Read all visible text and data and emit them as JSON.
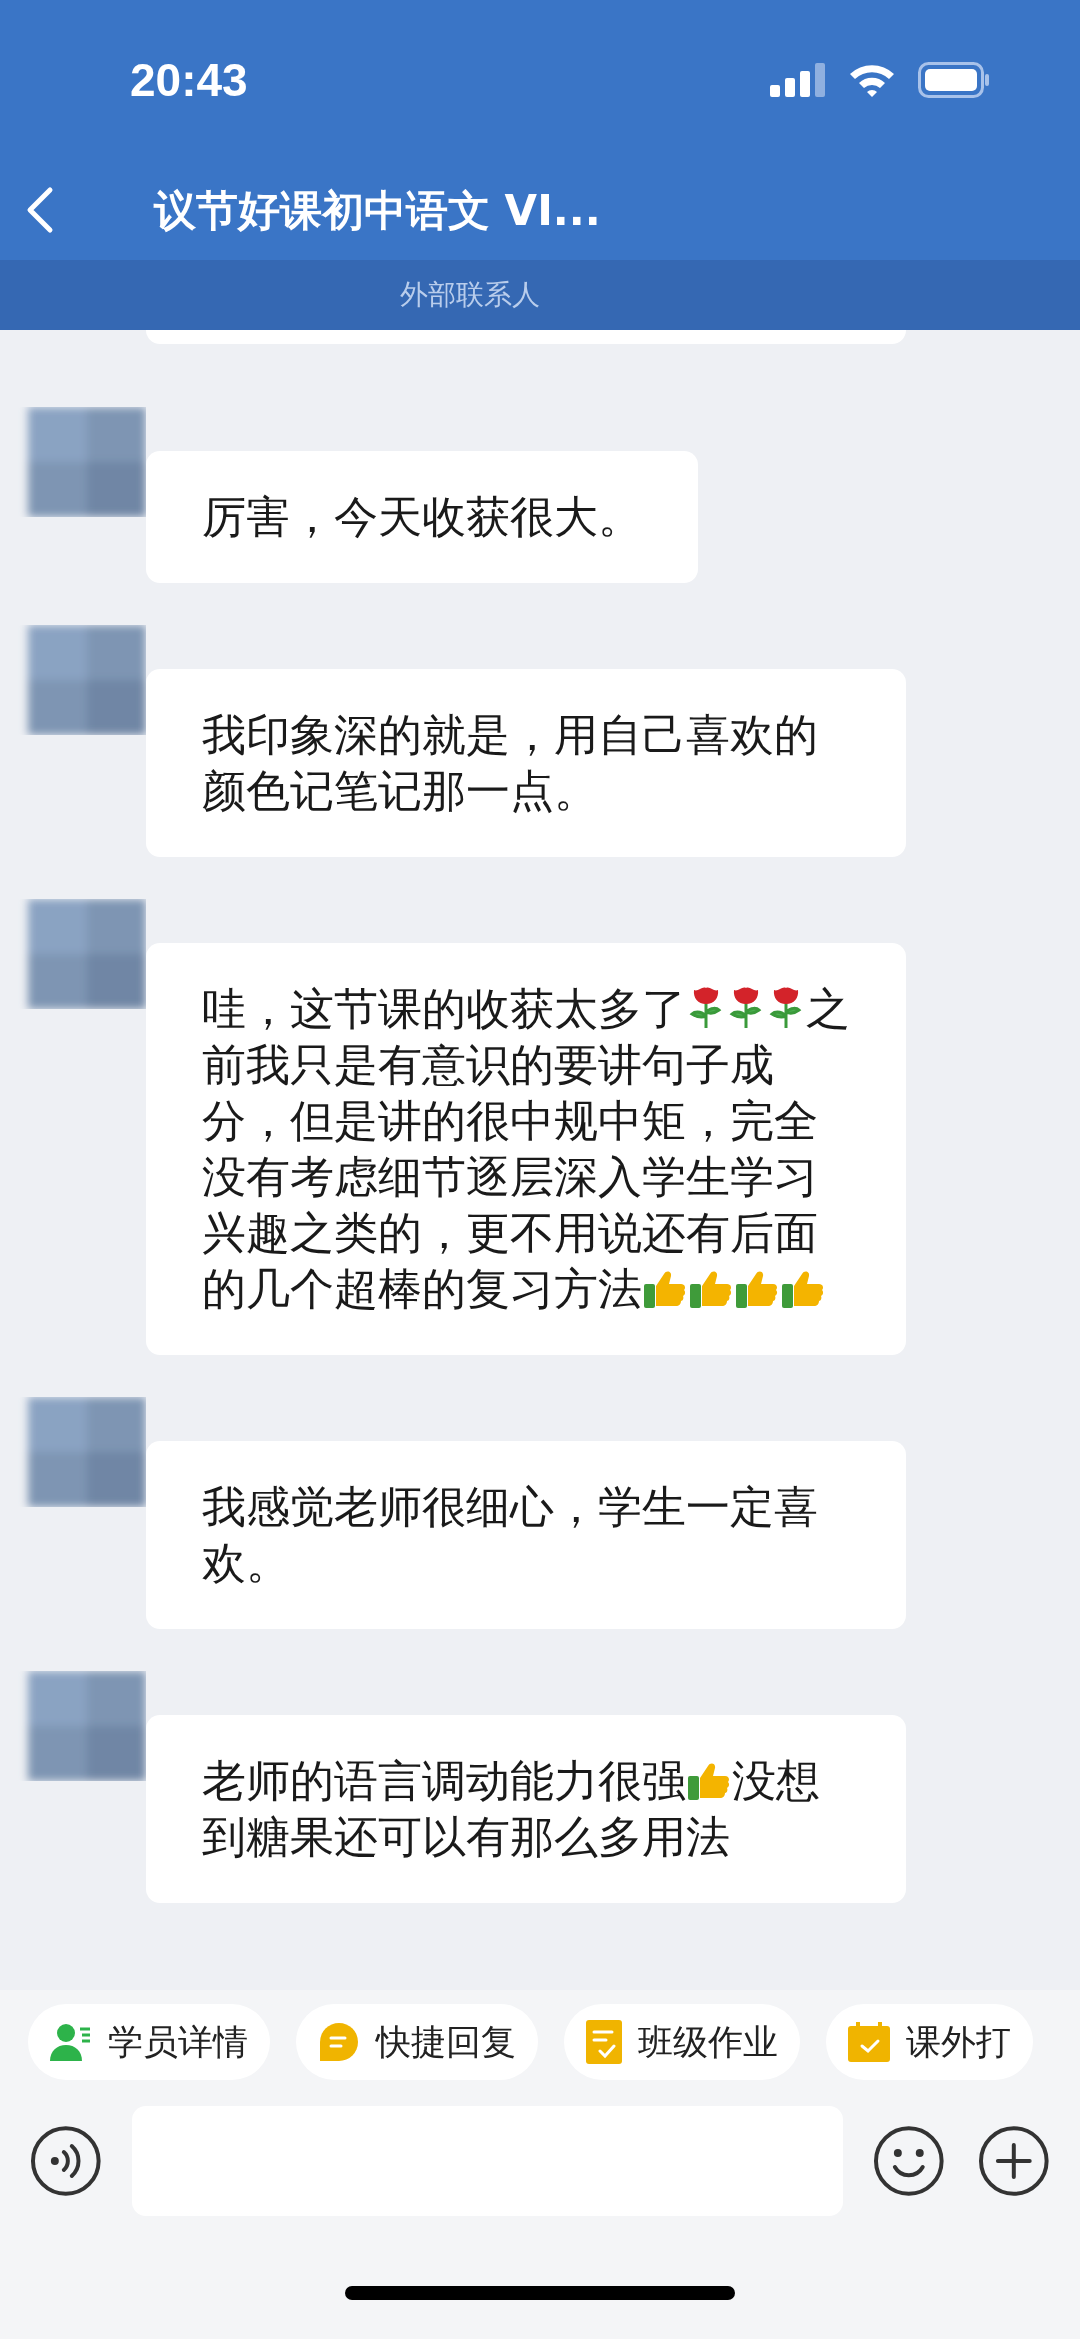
{
  "status_bar": {
    "time": "20:43"
  },
  "header": {
    "title": "议节好课初中语文 VI...",
    "subtitle": "外部联系人"
  },
  "messages": [
    {
      "segments": [
        {
          "kind": "text",
          "text": "厉害，今天收获很大。"
        }
      ]
    },
    {
      "segments": [
        {
          "kind": "text",
          "text": "我印象深的就是，用自己喜欢的颜色记笔记那一点。"
        }
      ]
    },
    {
      "segments": [
        {
          "kind": "text",
          "text": "哇，这节课的收获太多了"
        },
        {
          "kind": "rose"
        },
        {
          "kind": "rose"
        },
        {
          "kind": "rose"
        },
        {
          "kind": "text",
          "text": "之前我只是有意识的要讲句子成分，但是讲的很中规中矩，完全没有考虑细节逐层深入学生学习兴趣之类的，更不用说还有后面的几个超棒的复习方法"
        },
        {
          "kind": "thumbs"
        },
        {
          "kind": "thumbs"
        },
        {
          "kind": "thumbs"
        },
        {
          "kind": "thumbs"
        }
      ]
    },
    {
      "segments": [
        {
          "kind": "text",
          "text": "我感觉老师很细心，学生一定喜欢。"
        }
      ]
    },
    {
      "segments": [
        {
          "kind": "text",
          "text": "老师的语言调动能力很强"
        },
        {
          "kind": "thumbs"
        },
        {
          "kind": "text",
          "text": "没想到糖果还可以有那么多用法"
        }
      ]
    }
  ],
  "quick_actions": [
    {
      "label": "学员详情",
      "kind": "student"
    },
    {
      "label": "快捷回复",
      "kind": "reply"
    },
    {
      "label": "班级作业",
      "kind": "homework"
    },
    {
      "label": "课外打",
      "kind": "checkin"
    }
  ]
}
